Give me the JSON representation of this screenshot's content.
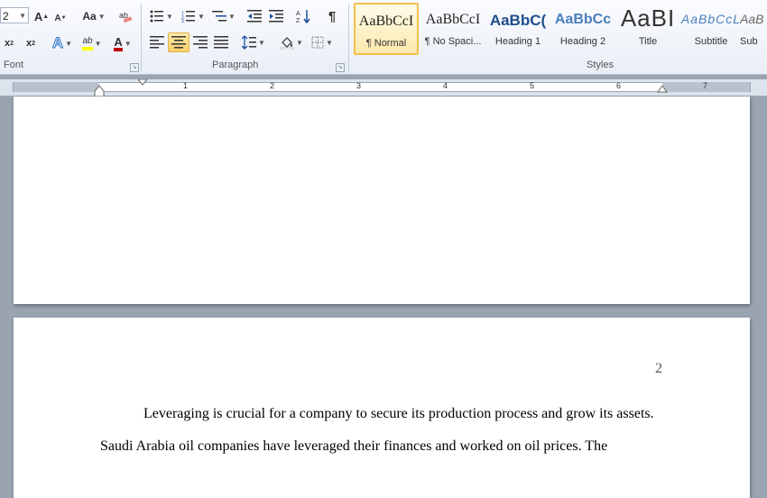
{
  "ribbon": {
    "font_size": "2",
    "groups": {
      "font": "Font",
      "paragraph": "Paragraph",
      "styles": "Styles"
    },
    "change_case_label": "Aa",
    "styles": [
      {
        "sample": "AaBbCcI",
        "label": "¶ Normal"
      },
      {
        "sample": "AaBbCcI",
        "label": "¶ No Spaci..."
      },
      {
        "sample": "AaBbC(",
        "label": "Heading 1"
      },
      {
        "sample": "AaBbCc",
        "label": "Heading 2"
      },
      {
        "sample": "AaBI",
        "label": "Title"
      },
      {
        "sample": "AaBbCcL",
        "label": "Subtitle"
      },
      {
        "sample": "AaB",
        "label": "Sub"
      }
    ]
  },
  "ruler": {
    "numbers": [
      "1",
      "2",
      "3",
      "4",
      "5",
      "6",
      "7"
    ]
  },
  "document": {
    "page_number": "2",
    "line1": "Leveraging is crucial for a company to secure its production process and grow its assets.",
    "line2": "Saudi Arabia oil companies have leveraged their finances and worked on oil prices. The"
  },
  "colors": {
    "highlight": "#ffff00",
    "font_color": "#c00000",
    "selected_style": "#f2c04b"
  }
}
